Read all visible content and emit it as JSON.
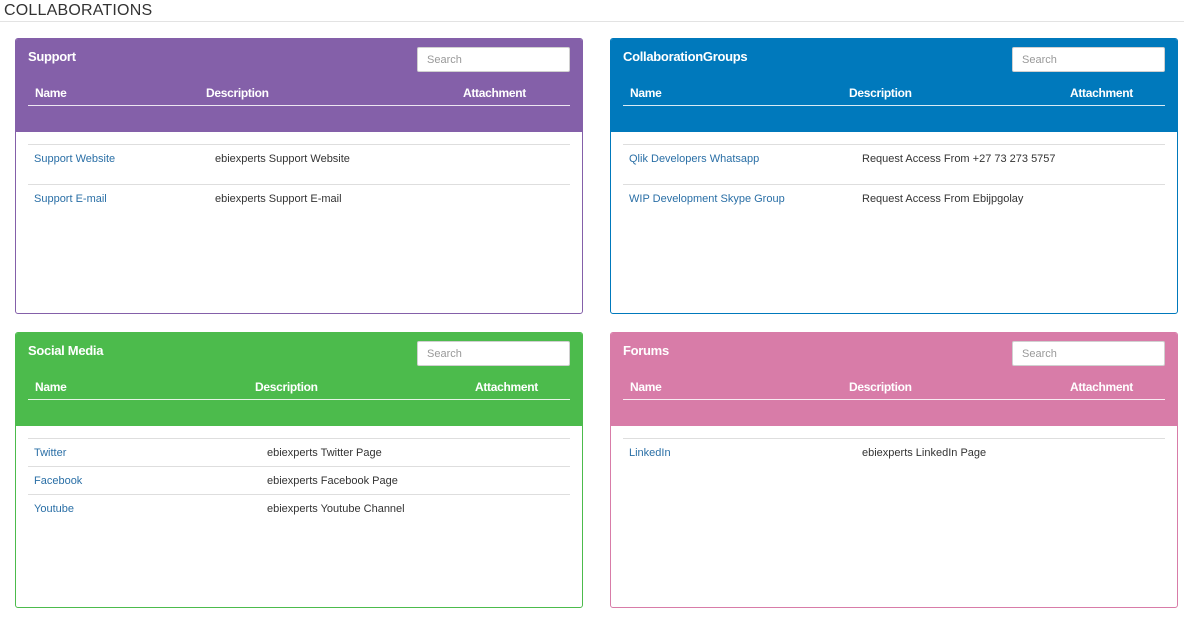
{
  "page": {
    "title": "COLLABORATIONS"
  },
  "columns": {
    "name": "Name",
    "description": "Description",
    "attachment": "Attachment"
  },
  "search_placeholder": "Search",
  "panels": [
    {
      "title": "Support",
      "color": "#8460a9",
      "rows": [
        {
          "name": "Support Website",
          "description": "ebiexperts Support Website"
        },
        {
          "name": "Support E-mail",
          "description": "ebiexperts Support E-mail"
        }
      ]
    },
    {
      "title": "CollaborationGroups",
      "color": "#0079bc",
      "rows": [
        {
          "name": "Qlik Developers Whatsapp",
          "description": "Request Access From +27 73 273 5757"
        },
        {
          "name": "WIP Development Skype Group",
          "description": "Request Access From Ebijpgolay"
        }
      ]
    },
    {
      "title": "Social Media",
      "color": "#4cbb4c",
      "rows": [
        {
          "name": "Twitter",
          "description": "ebiexperts Twitter Page"
        },
        {
          "name": "Facebook",
          "description": "ebiexperts Facebook Page"
        },
        {
          "name": "Youtube",
          "description": "ebiexperts Youtube Channel"
        }
      ]
    },
    {
      "title": "Forums",
      "color": "#d87ca8",
      "rows": [
        {
          "name": "LinkedIn",
          "description": "ebiexperts LinkedIn Page"
        }
      ]
    }
  ]
}
